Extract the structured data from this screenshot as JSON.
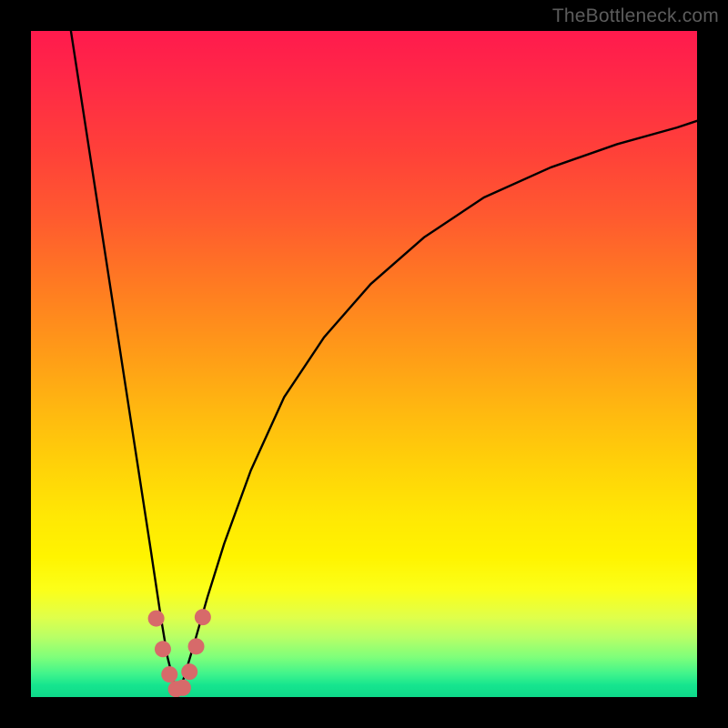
{
  "watermark": "TheBottleneck.com",
  "chart_data": {
    "type": "line",
    "title": "",
    "xlabel": "",
    "ylabel": "",
    "xlim": [
      0,
      100
    ],
    "ylim": [
      0,
      100
    ],
    "notch_x": 22,
    "series": [
      {
        "name": "left-branch",
        "x": [
          6,
          8,
          10,
          12,
          14,
          16,
          18,
          19.5,
          20.5,
          21.5,
          22
        ],
        "y": [
          100,
          87,
          74,
          61,
          48,
          35,
          22,
          12,
          6,
          2,
          0
        ]
      },
      {
        "name": "right-branch",
        "x": [
          22,
          23,
          24.5,
          26.5,
          29,
          33,
          38,
          44,
          51,
          59,
          68,
          78,
          88,
          97,
          100
        ],
        "y": [
          0,
          3,
          8,
          15,
          23,
          34,
          45,
          54,
          62,
          69,
          75,
          79.5,
          83,
          85.5,
          86.5
        ]
      }
    ],
    "markers": {
      "name": "marker-dots",
      "color": "#d76a6a",
      "points": [
        {
          "x": 18.8,
          "y": 11.8
        },
        {
          "x": 19.8,
          "y": 7.2
        },
        {
          "x": 20.8,
          "y": 3.4
        },
        {
          "x": 21.8,
          "y": 1.2
        },
        {
          "x": 22.8,
          "y": 1.4
        },
        {
          "x": 23.8,
          "y": 3.8
        },
        {
          "x": 24.8,
          "y": 7.6
        },
        {
          "x": 25.8,
          "y": 12.0
        }
      ]
    },
    "gradient_stops": [
      {
        "pos": 0,
        "color": "#ff1a4d"
      },
      {
        "pos": 0.5,
        "color": "#ffb810"
      },
      {
        "pos": 0.8,
        "color": "#fff400"
      },
      {
        "pos": 1.0,
        "color": "#0ed98a"
      }
    ]
  }
}
